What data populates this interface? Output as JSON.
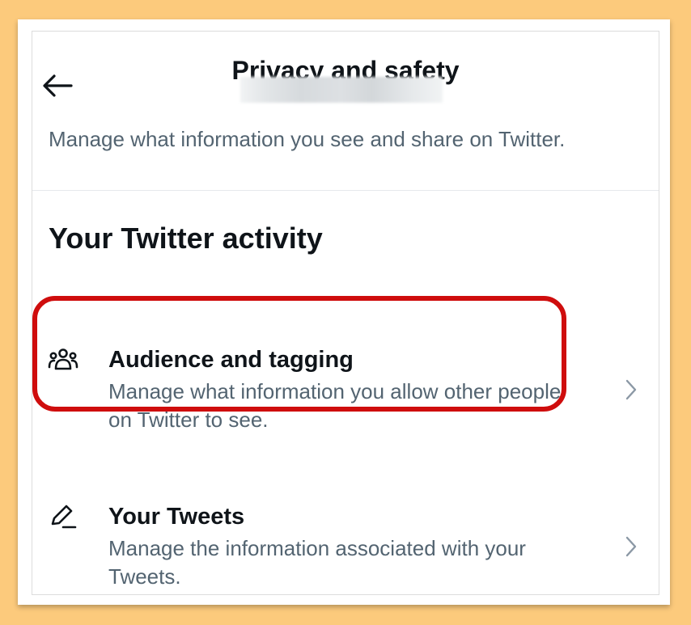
{
  "header": {
    "title": "Privacy and safety",
    "back_icon": "arrow-left-icon"
  },
  "intro": "Manage what information you see and share on Twitter.",
  "section": {
    "heading": "Your Twitter activity"
  },
  "items": [
    {
      "title": "Audience and tagging",
      "description": "Manage what information you allow other people on Twitter to see.",
      "icon": "people-group-icon",
      "highlighted": true
    },
    {
      "title": "Your Tweets",
      "description": "Manage the information associated with your Tweets.",
      "icon": "pencil-icon",
      "highlighted": false
    }
  ],
  "colors": {
    "highlight": "#cf0d0d",
    "text_primary": "#0f1419",
    "text_secondary": "#536471",
    "background": "#fcca7c"
  }
}
